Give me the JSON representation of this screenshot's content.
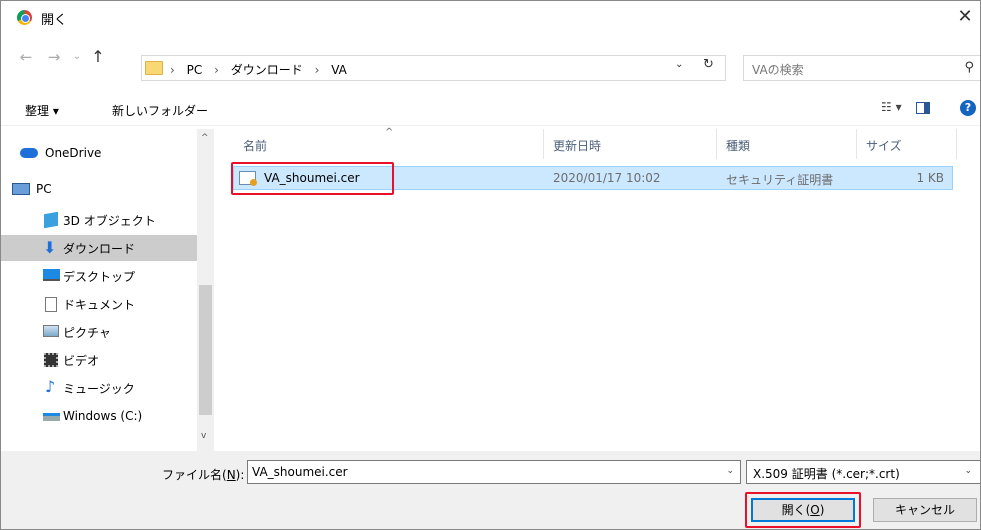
{
  "window": {
    "title": "開く",
    "close_glyph": "✕"
  },
  "nav": {
    "back_glyph": "←",
    "forward_glyph": "→",
    "recent_glyph": "⌄",
    "up_glyph": "↑"
  },
  "address": {
    "crumbs": [
      "PC",
      "ダウンロード",
      "VA"
    ],
    "separator": "›",
    "dropdown_glyph": "⌄",
    "refresh_glyph": "↻"
  },
  "search": {
    "placeholder": "VAの検索",
    "icon_glyph": "⚲"
  },
  "toolbar": {
    "organize_label": "整理 ▾",
    "new_folder_label": "新しいフォルダー",
    "view_glyph": "☷ ▾",
    "help_glyph": "?"
  },
  "sidebar": {
    "items": [
      {
        "label": "OneDrive",
        "icon": "cloud-icon"
      },
      {
        "label": "PC",
        "icon": "computer-icon"
      },
      {
        "label": "3D オブジェクト",
        "icon": "cube-icon"
      },
      {
        "label": "ダウンロード",
        "icon": "download-icon"
      },
      {
        "label": "デスクトップ",
        "icon": "desktop-icon"
      },
      {
        "label": "ドキュメント",
        "icon": "document-icon"
      },
      {
        "label": "ピクチャ",
        "icon": "picture-icon"
      },
      {
        "label": "ビデオ",
        "icon": "video-icon"
      },
      {
        "label": "ミュージック",
        "icon": "music-icon"
      },
      {
        "label": "Windows (C:)",
        "icon": "drive-icon"
      }
    ],
    "selected": "ダウンロード",
    "scroll_up_glyph": "^",
    "scroll_down_glyph": "v"
  },
  "filelist": {
    "columns": [
      "名前",
      "更新日時",
      "種類",
      "サイズ"
    ],
    "sort_glyph": "^",
    "rows": [
      {
        "name": "VA_shoumei.cer",
        "modified": "2020/01/17 10:02",
        "type": "セキュリティ証明書",
        "size": "1 KB"
      }
    ]
  },
  "footer": {
    "filename_label_prefix": "ファイル名(",
    "filename_label_key": "N",
    "filename_label_suffix": "):",
    "filename_value": "VA_shoumei.cer",
    "filetype_value": "X.509 証明書 (*.cer;*.crt)",
    "dropdown_glyph": "⌄",
    "open_label_prefix": "開く(",
    "open_label_key": "O",
    "open_label_suffix": ")",
    "cancel_label": "キャンセル"
  },
  "colors": {
    "highlight": "#e8102a",
    "selection": "#cce8ff",
    "accent": "#0078d7"
  }
}
